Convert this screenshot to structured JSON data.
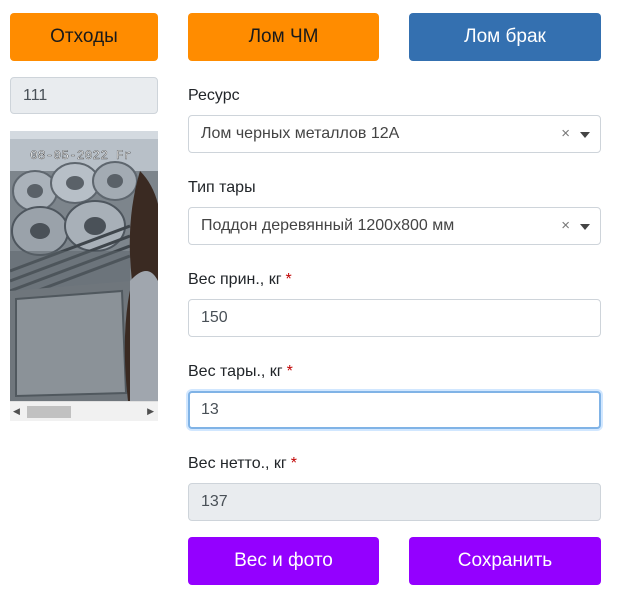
{
  "top_buttons": {
    "waste": "Отходы",
    "scrap_ferrous": "Лом ЧМ",
    "scrap_defect": "Лом брак"
  },
  "record_id": "111",
  "camera": {
    "timestamp_overlay": "08-05-2022 Fr"
  },
  "form": {
    "resource": {
      "label": "Ресурс",
      "value": "Лом черных металлов 12А"
    },
    "container_type": {
      "label": "Тип тары",
      "value": "Поддон деревянный 1200х800 мм"
    },
    "gross_weight": {
      "label": "Вес прин., кг",
      "required_mark": "*",
      "value": "150"
    },
    "tare_weight": {
      "label": "Вес тары., кг",
      "required_mark": "*",
      "value": "13"
    },
    "net_weight": {
      "label": "Вес нетто., кг",
      "required_mark": "*",
      "value": "137"
    },
    "clear_symbol": "×"
  },
  "bottom_buttons": {
    "weigh_photo": "Вес и фото",
    "save": "Сохранить"
  },
  "colors": {
    "orange": "#ff8c00",
    "blue": "#3470b0",
    "purple": "#9400ff"
  }
}
